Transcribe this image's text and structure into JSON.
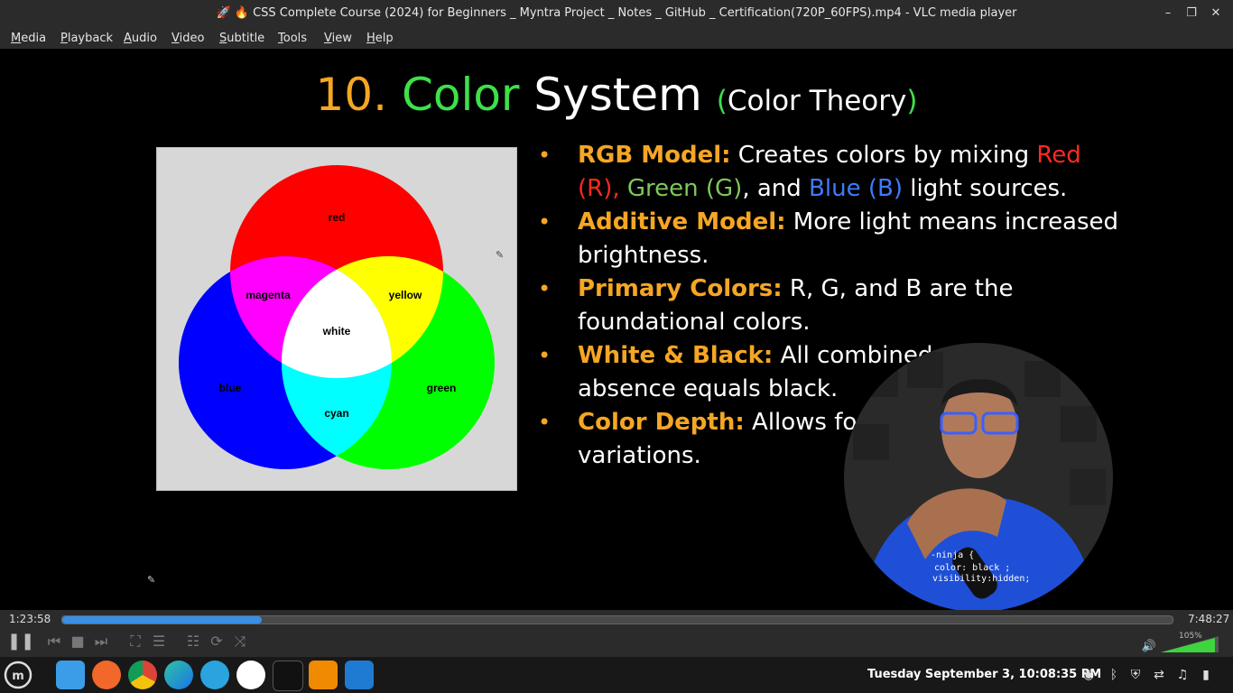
{
  "window": {
    "title": "🚀 🔥 CSS Complete Course (2024) for Beginners _ Myntra Project _ Notes _ GitHub _ Certification(720P_60FPS).mp4 - VLC media player"
  },
  "menu": [
    "Media",
    "Playback",
    "Audio",
    "Video",
    "Subtitle",
    "Tools",
    "View",
    "Help"
  ],
  "slide": {
    "number": "10.",
    "title_color_word": "Color",
    "title_rest": "System",
    "subtitle_open": "(",
    "subtitle_text": "Color Theory",
    "subtitle_close": ")",
    "venn_labels": {
      "red": "red",
      "magenta": "magenta",
      "yellow": "yellow",
      "white": "white",
      "blue": "blue",
      "green": "green",
      "cyan": "cyan"
    },
    "bullets": [
      {
        "key": "RGB Model:",
        "text": " Creates colors by mixing ",
        "red": "Red (R),",
        "green": "Green (G)",
        "mid": ", and ",
        "blue": "Blue (B)",
        "end": " light sources."
      },
      {
        "key": "Additive Model:",
        "text": " More light means increased brightness."
      },
      {
        "key": "Primary Colors:",
        "text": " R, G, and B are the foundational colors."
      },
      {
        "key": "White & Black:",
        "text": " All combined vi"
      },
      {
        "key": "Color Depth:",
        "text": " Allows for r"
      }
    ],
    "bullet4_line2": "absence equals black.",
    "bullet5_line2": "variations."
  },
  "webcam": {
    "shirt_line1": "-ninja {",
    "shirt_line2": "color: black ;",
    "shirt_line3": "visibility:hidden;"
  },
  "player": {
    "elapsed": "1:23:58",
    "total": "7:48:27",
    "progress_fraction": 0.18,
    "volume": "105%",
    "accent_color": "#3a8ee6"
  },
  "taskbar": {
    "clock": "Tuesday September  3, 10:08:35 PM"
  }
}
